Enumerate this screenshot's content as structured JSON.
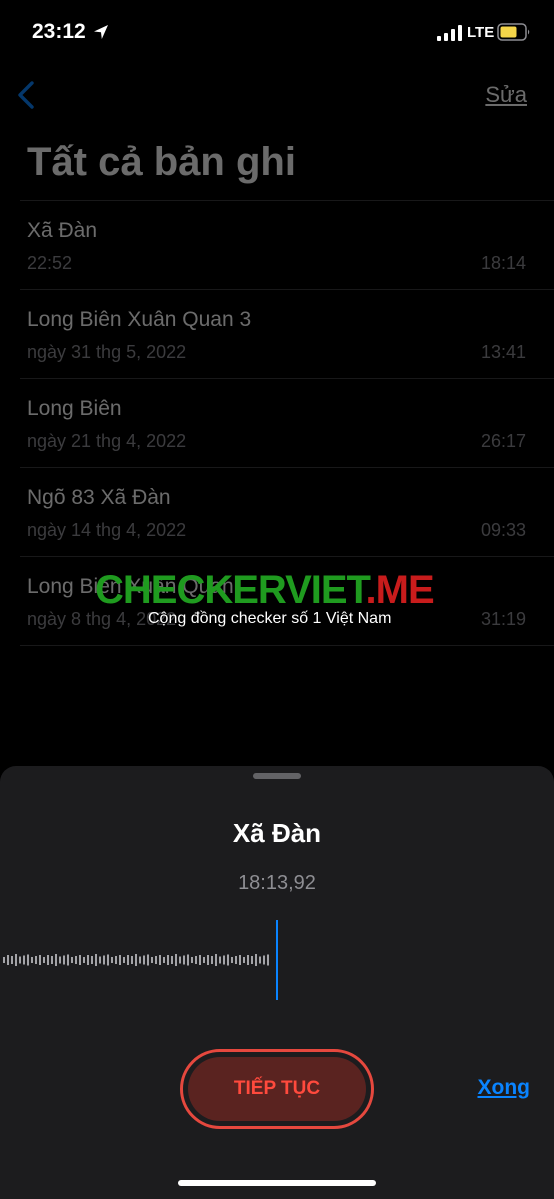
{
  "status_bar": {
    "time": "23:12",
    "network": "LTE",
    "icons": [
      "location-arrow-icon",
      "cellular-signal-icon",
      "battery-icon"
    ],
    "battery_color": "#f5d64a"
  },
  "nav": {
    "back_icon": "chevron-left-icon",
    "edit_label": "Sửa",
    "accent_color": "#0a84ff"
  },
  "page": {
    "title": "Tất cả bản ghi"
  },
  "recordings": [
    {
      "title": "Xã Đàn",
      "date": "22:52",
      "duration": "18:14"
    },
    {
      "title": "Long Biên Xuân Quan 3",
      "date": "ngày 31 thg 5, 2022",
      "duration": "13:41"
    },
    {
      "title": "Long Biên",
      "date": "ngày 21 thg 4, 2022",
      "duration": "26:17"
    },
    {
      "title": "Ngõ 83 Xã Đàn",
      "date": "ngày 14 thg 4, 2022",
      "duration": "09:33"
    },
    {
      "title": "Long Biên Xuân Quan",
      "date": "ngày 8 thg 4, 2022",
      "duration": "31:19"
    }
  ],
  "watermark": {
    "brand_part1": "CHECKERVIET",
    "brand_part2": ".ME",
    "tagline": "Cộng đồng checker số 1 Việt Nam"
  },
  "player": {
    "title": "Xã Đàn",
    "elapsed": "18:13,92",
    "resume_label": "TIẾP TỤC",
    "done_label": "Xong",
    "resume_color": "#ff4a3d",
    "playhead_color": "#0a84ff"
  }
}
